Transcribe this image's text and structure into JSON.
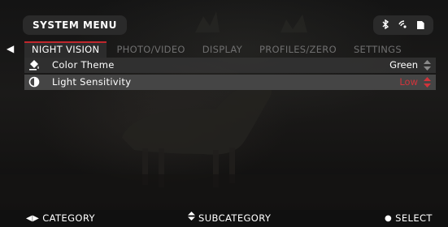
{
  "header": {
    "title": "SYSTEM MENU",
    "status_icons": [
      "bluetooth-icon",
      "wifi-icon",
      "sd-card-icon"
    ],
    "sd_label": "SD"
  },
  "tabs": [
    {
      "label": "NIGHT VISION",
      "active": true
    },
    {
      "label": "PHOTO/VIDEO",
      "active": false
    },
    {
      "label": "DISPLAY",
      "active": false
    },
    {
      "label": "PROFILES/ZERO",
      "active": false
    },
    {
      "label": "SETTINGS",
      "active": false
    }
  ],
  "settings": [
    {
      "label": "Color Theme",
      "value": "Green",
      "icon": "paint-bucket-icon",
      "selected": false
    },
    {
      "label": "Light Sensitivity",
      "value": "Low",
      "icon": "brightness-icon",
      "selected": true
    }
  ],
  "footer": {
    "category": "CATEGORY",
    "subcategory": "SUBCATEGORY",
    "select": "SELECT"
  },
  "colors": {
    "accent_red": "#c0272d",
    "value_red": "#d1343b",
    "inactive_tab": "#6f6f6f"
  }
}
